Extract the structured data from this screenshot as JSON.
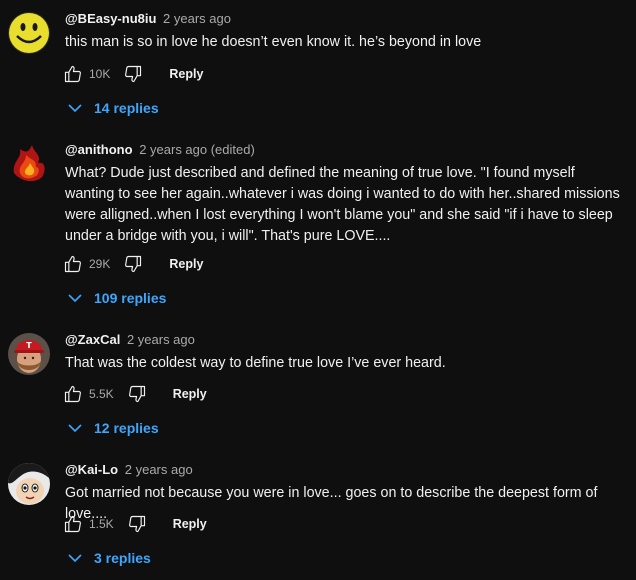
{
  "comments": [
    {
      "author": "@BEasy-nu8iu",
      "time": "2 years ago",
      "text": "this man is so in love he doesn’t even know it. he’s beyond in love",
      "likes": "10K",
      "reply_label": "Reply",
      "replies_label": "14 replies",
      "avatar_icon": "smiley-face-icon"
    },
    {
      "author": "@anithono",
      "time": "2 years ago (edited)",
      "text": "What? Dude just described and defined the meaning of true love. \"I found myself wanting to see her again..whatever i was doing i wanted to do with her..shared missions were alligned..when I lost everything I won't blame you\" and she said \"if i have to sleep under a bridge with you, i will\". That's pure LOVE....",
      "likes": "29K",
      "reply_label": "Reply",
      "replies_label": "109 replies",
      "avatar_icon": "fire-icon"
    },
    {
      "author": "@ZaxCal",
      "time": "2 years ago",
      "text": "That was the coldest way to define true love I’ve ever heard.",
      "likes": "5.5K",
      "reply_label": "Reply",
      "replies_label": "12 replies",
      "avatar_icon": "bearded-man-cap-icon"
    },
    {
      "author": "@Kai-Lo",
      "time": "2 years ago",
      "text": "Got married not because you were in love... goes on to describe the deepest form of love....",
      "likes": "1.5K",
      "reply_label": "Reply",
      "replies_label": "3 replies",
      "avatar_icon": "anime-character-icon"
    }
  ]
}
